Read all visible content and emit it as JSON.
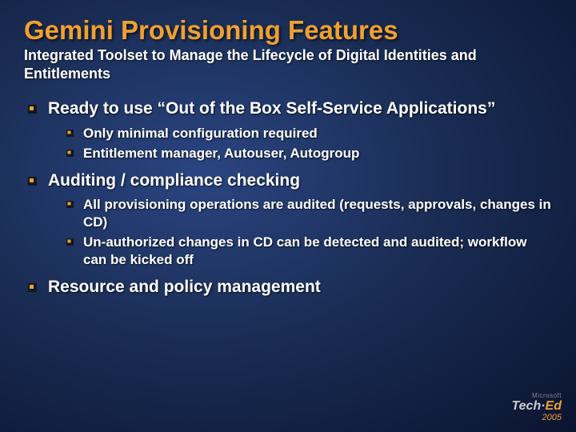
{
  "title": "Gemini Provisioning Features",
  "subtitle": "Integrated Toolset to Manage the Lifecycle of Digital Identities and Entitlements",
  "bullets": [
    {
      "text": "Ready to use “Out of the Box Self-Service Applications”",
      "sub": [
        {
          "text": "Only minimal configuration required"
        },
        {
          "text": "Entitlement manager, Autouser, Autogroup"
        }
      ]
    },
    {
      "text": "Auditing / compliance checking",
      "sub": [
        {
          "text": "All provisioning operations are audited (requests, approvals, changes in CD)"
        },
        {
          "text": "Un-authorized changes in CD can be detected and audited; workflow can be kicked off"
        }
      ]
    },
    {
      "text": "Resource and policy management",
      "sub": []
    }
  ],
  "footer": {
    "brand_top": "Microsoft",
    "brand_main_a": "Tech·",
    "brand_main_b": "Ed",
    "year": "2005"
  }
}
